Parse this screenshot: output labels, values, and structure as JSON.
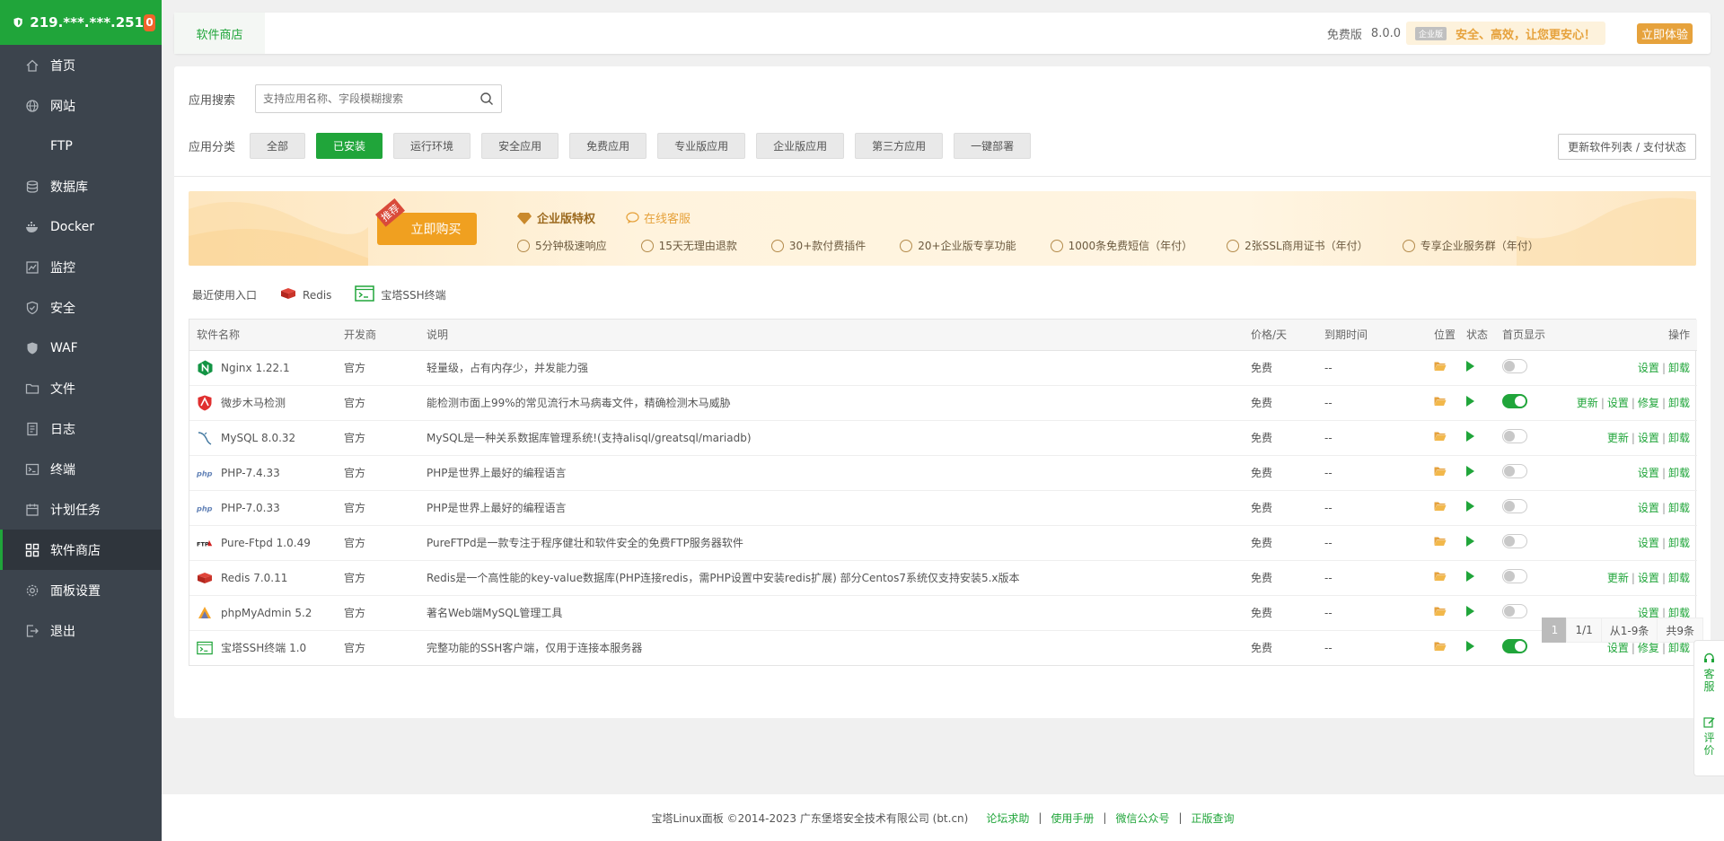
{
  "server": {
    "ip": "219.***.***.251",
    "notify_count": "0"
  },
  "nav": [
    {
      "label": "首页",
      "icon": "home-icon"
    },
    {
      "label": "网站",
      "icon": "globe-icon"
    },
    {
      "label": "FTP",
      "icon": "ftp-icon"
    },
    {
      "label": "数据库",
      "icon": "database-icon"
    },
    {
      "label": "Docker",
      "icon": "docker-icon"
    },
    {
      "label": "监控",
      "icon": "monitor-icon"
    },
    {
      "label": "安全",
      "icon": "shield-check-icon"
    },
    {
      "label": "WAF",
      "icon": "waf-shield-icon"
    },
    {
      "label": "文件",
      "icon": "folder-icon"
    },
    {
      "label": "日志",
      "icon": "log-icon"
    },
    {
      "label": "终端",
      "icon": "terminal-icon"
    },
    {
      "label": "计划任务",
      "icon": "calendar-icon"
    },
    {
      "label": "软件商店",
      "icon": "app-grid-icon",
      "active": true
    },
    {
      "label": "面板设置",
      "icon": "gear-icon"
    },
    {
      "label": "退出",
      "icon": "logout-icon"
    }
  ],
  "topbar": {
    "tab": "软件商店",
    "edition": "免费版",
    "version": "8.0.0",
    "enterprise_tag": "企业版",
    "promo": "安全、高效，让您更安心！",
    "try_label": "立即体验"
  },
  "search": {
    "label": "应用搜索",
    "placeholder": "支持应用名称、字段模糊搜索"
  },
  "categories": {
    "label": "应用分类",
    "items": [
      "全部",
      "已安装",
      "运行环境",
      "安全应用",
      "免费应用",
      "专业版应用",
      "企业版应用",
      "第三方应用",
      "一键部署"
    ],
    "active_index": 1,
    "refresh_label": "更新软件列表 / 支付状态"
  },
  "banner": {
    "recommend": "推荐",
    "buy_label": "立即购买",
    "perk_title": "企业版特权",
    "service_label": "在线客服",
    "perks": [
      "5分钟极速响应",
      "15天无理由退款",
      "30+款付费插件",
      "20+企业版专享功能",
      "1000条免费短信（年付）",
      "2张SSL商用证书（年付）",
      "专享企业服务群（年付）"
    ]
  },
  "recent": {
    "label": "最近使用入口",
    "items": [
      {
        "name": "Redis",
        "icon": "redis-icon"
      },
      {
        "name": "宝塔SSH终端",
        "icon": "ssh-terminal-icon"
      }
    ]
  },
  "table": {
    "headers": [
      "软件名称",
      "开发商",
      "说明",
      "价格/天",
      "到期时间",
      "位置",
      "状态",
      "首页显示",
      "操作"
    ],
    "rows": [
      {
        "name": "Nginx 1.22.1",
        "icon": "nginx-icon",
        "dev": "官方",
        "desc": "轻量级，占有内存少，并发能力强",
        "price": "免费",
        "expire": "--",
        "home": false,
        "ops": [
          "设置",
          "卸载"
        ]
      },
      {
        "name": "微步木马检测",
        "icon": "trojan-scan-icon",
        "dev": "官方",
        "desc": "能检测市面上99%的常见流行木马病毒文件，精确检测木马威胁",
        "price": "免费",
        "expire": "--",
        "home": true,
        "ops": [
          "更新",
          "设置",
          "修复",
          "卸载"
        ]
      },
      {
        "name": "MySQL 8.0.32",
        "icon": "mysql-icon",
        "dev": "官方",
        "desc": "MySQL是一种关系数据库管理系统!(支持alisql/greatsql/mariadb)",
        "price": "免费",
        "expire": "--",
        "home": false,
        "ops": [
          "更新",
          "设置",
          "卸载"
        ]
      },
      {
        "name": "PHP-7.4.33",
        "icon": "php-icon",
        "dev": "官方",
        "desc": "PHP是世界上最好的编程语言",
        "price": "免费",
        "expire": "--",
        "home": false,
        "ops": [
          "设置",
          "卸载"
        ]
      },
      {
        "name": "PHP-7.0.33",
        "icon": "php-icon",
        "dev": "官方",
        "desc": "PHP是世界上最好的编程语言",
        "price": "免费",
        "expire": "--",
        "home": false,
        "ops": [
          "设置",
          "卸载"
        ]
      },
      {
        "name": "Pure-Ftpd 1.0.49",
        "icon": "ftp-logo-icon",
        "dev": "官方",
        "desc": "PureFTPd是一款专注于程序健壮和软件安全的免费FTP服务器软件",
        "price": "免费",
        "expire": "--",
        "home": false,
        "ops": [
          "设置",
          "卸载"
        ]
      },
      {
        "name": "Redis 7.0.11",
        "icon": "redis-icon",
        "dev": "官方",
        "desc": "Redis是一个高性能的key-value数据库(PHP连接redis，需PHP设置中安装redis扩展) 部分Centos7系统仅支持安装5.x版本",
        "price": "免费",
        "expire": "--",
        "home": false,
        "ops": [
          "更新",
          "设置",
          "卸载"
        ]
      },
      {
        "name": "phpMyAdmin 5.2",
        "icon": "phpmyadmin-icon",
        "dev": "官方",
        "desc": "著名Web端MySQL管理工具",
        "price": "免费",
        "expire": "--",
        "home": false,
        "ops": [
          "设置",
          "卸载"
        ]
      },
      {
        "name": "宝塔SSH终端 1.0",
        "icon": "ssh-terminal-icon",
        "dev": "官方",
        "desc": "完整功能的SSH客户端，仅用于连接本服务器",
        "price": "免费",
        "expire": "--",
        "home": true,
        "ops": [
          "设置",
          "修复",
          "卸载"
        ]
      }
    ]
  },
  "pager": {
    "current": "1",
    "pages": "1/1",
    "range": "从1-9条",
    "total": "共9条"
  },
  "footer": {
    "copyright": "宝塔Linux面板 ©2014-2023 广东堡塔安全技术有限公司 (bt.cn)",
    "links": [
      "论坛求助",
      "使用手册",
      "微信公众号",
      "正版查询"
    ]
  },
  "float": {
    "service": "客服",
    "review": "评价"
  },
  "colors": {
    "brand": "#20a53a",
    "sidebar": "#3c444d",
    "accent": "#e6a23c",
    "badge": "#f0642a"
  }
}
